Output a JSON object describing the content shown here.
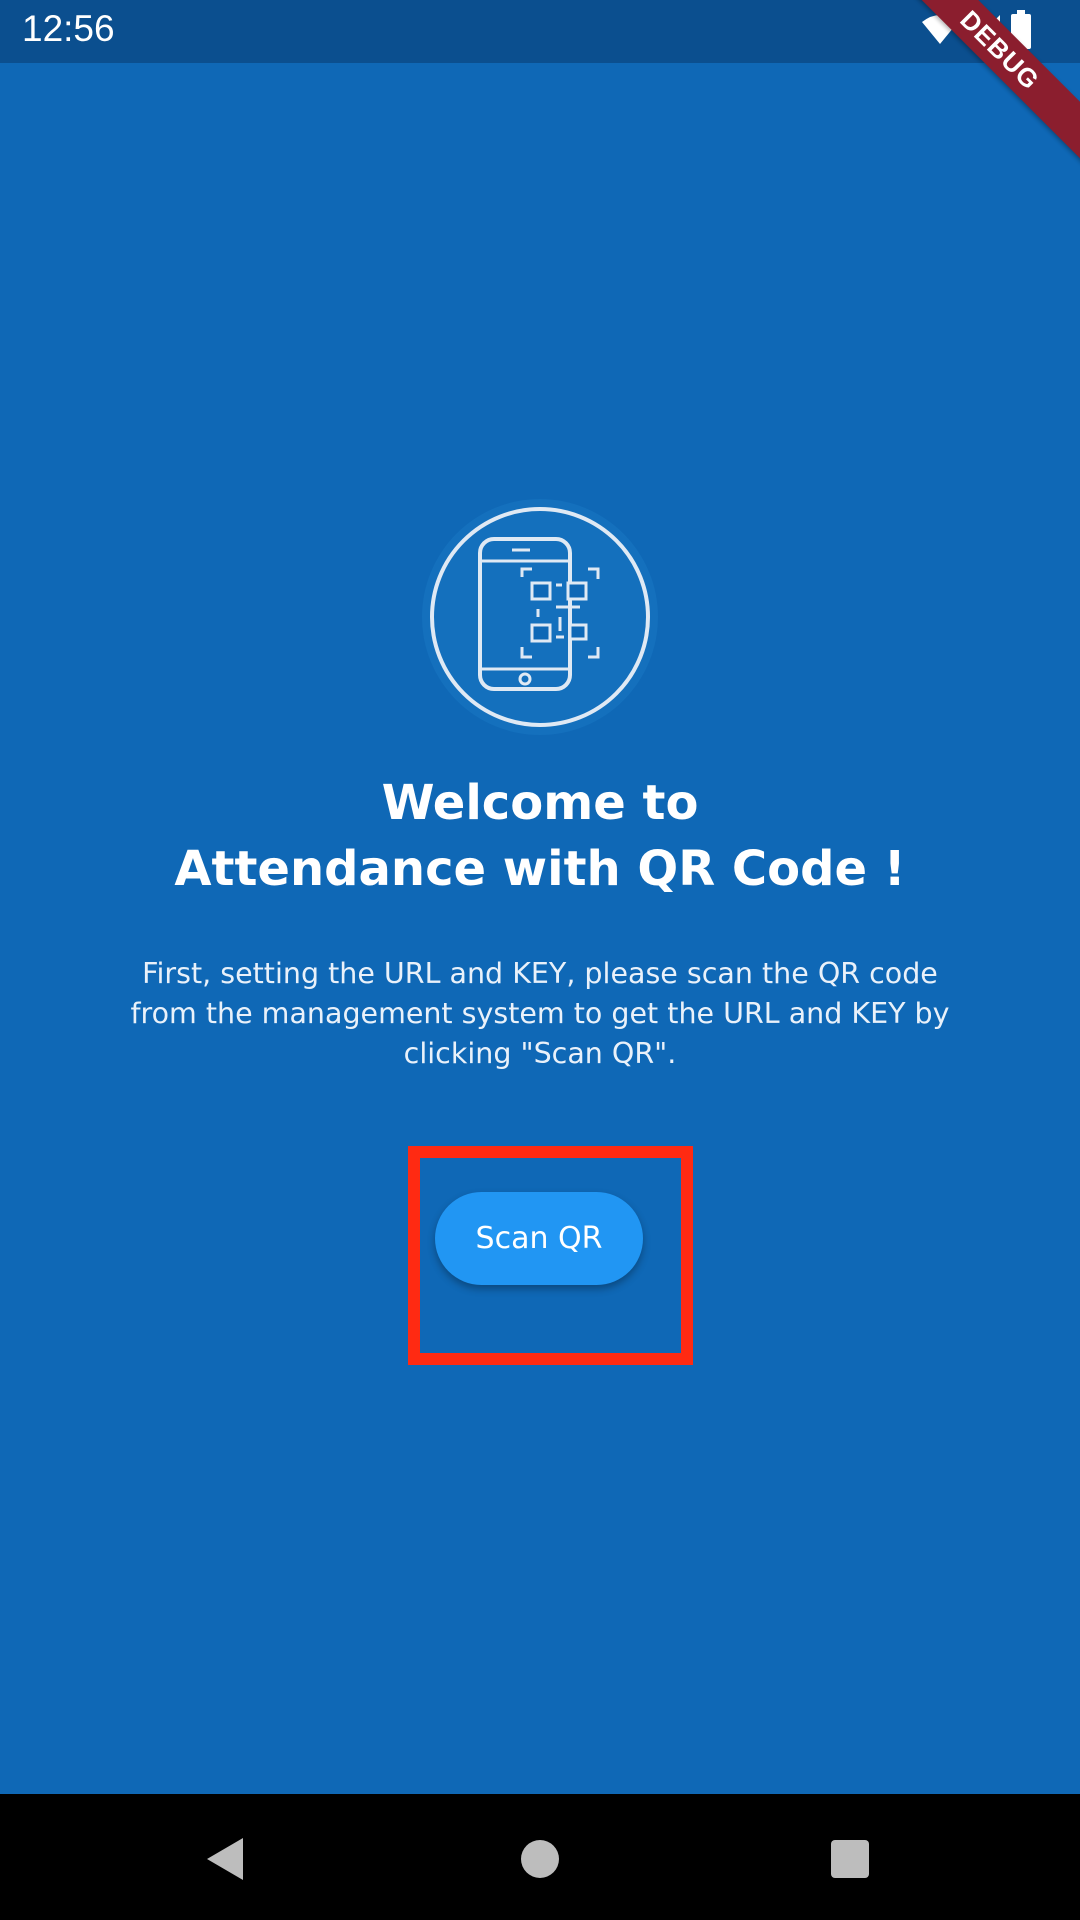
{
  "status_bar": {
    "time": "12:56",
    "icons": [
      "wifi-icon",
      "signal-icon",
      "battery-icon"
    ]
  },
  "debug_banner": {
    "label": "DEBUG"
  },
  "main": {
    "title_line1": "Welcome to",
    "title_line2": "Attendance with QR Code !",
    "description": "First, setting the URL and KEY, please scan the QR code from the management system to get the URL and KEY by clicking \"Scan QR\".",
    "scan_button_label": "Scan QR"
  },
  "nav_bar": {
    "buttons": [
      "back-button",
      "home-button",
      "recents-button"
    ]
  },
  "colors": {
    "background": "#0f68b6",
    "status_bar": "#0b4f8f",
    "button": "#2196f3",
    "highlight": "#ff2a12",
    "debug_banner": "#8b1e2e"
  }
}
